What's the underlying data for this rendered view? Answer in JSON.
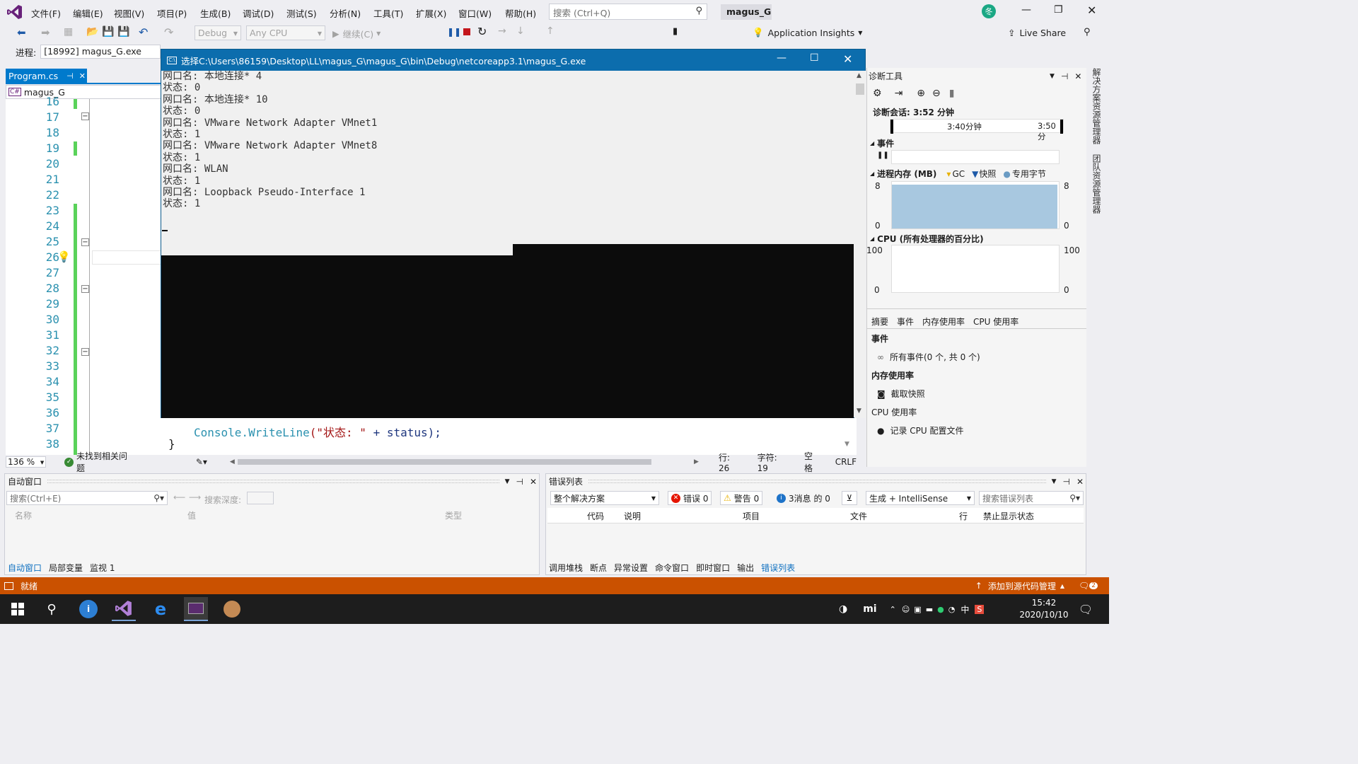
{
  "app": {
    "menu": [
      "文件(F)",
      "编辑(E)",
      "视图(V)",
      "项目(P)",
      "生成(B)",
      "调试(D)",
      "测试(S)",
      "分析(N)",
      "工具(T)",
      "扩展(X)",
      "窗口(W)",
      "帮助(H)"
    ],
    "search_placeholder": "搜索 (Ctrl+Q)",
    "solution_name": "magus_G",
    "user_initial": "冬",
    "accent": "#007acc"
  },
  "toolbar": {
    "config": "Debug",
    "platform": "Any CPU",
    "continue": "继续(C)",
    "app_insights": "Application Insights",
    "live_share": "Live Share",
    "process_label": "进程:",
    "process_value": "[18992] magus_G.exe"
  },
  "editor": {
    "tab_label": "Program.cs",
    "nav_left": "magus_G",
    "line_numbers": [
      "16",
      "17",
      "18",
      "19",
      "20",
      "21",
      "22",
      "23",
      "24",
      "25",
      "26",
      "27",
      "28",
      "29",
      "30",
      "31",
      "32",
      "33",
      "34",
      "35",
      "36",
      "37",
      "38"
    ],
    "code_line_37_method": "Console.WriteLine",
    "code_line_37_str": "(\"状态: \"",
    "code_line_37_tail": " + status);",
    "code_line_38": "}",
    "zoom": "136 %",
    "status_msg": "未找到相关问题",
    "pos_line": "行: 26",
    "pos_char": "字符: 19",
    "whitespace": "空格",
    "eol": "CRLF"
  },
  "console": {
    "title": "选择C:\\Users\\86159\\Desktop\\LL\\magus_G\\magus_G\\bin\\Debug\\netcoreapp3.1\\magus_G.exe",
    "lines": [
      "网口名: 本地连接* 4",
      "状态: 0",
      "网口名: 本地连接* 10",
      "状态: 0",
      "网口名: VMware Network Adapter VMnet1",
      "状态: 1",
      "网口名: VMware Network Adapter VMnet8",
      "状态: 1",
      "网口名: WLAN",
      "状态: 1",
      "网口名: Loopback Pseudo-Interface 1",
      "状态: 1"
    ]
  },
  "diag": {
    "title": "诊断工具",
    "session": "诊断会话: 3:52 分钟",
    "tick1": "3:40分钟",
    "tick2": "3:50分",
    "events": "事件",
    "memory": "进程内存 (MB)",
    "gc": "GC",
    "snapshot": "快照",
    "private_bytes": "专用字节",
    "mem_max": "8",
    "mem_min": "0",
    "cpu": "CPU (所有处理器的百分比)",
    "cpu_max": "100",
    "cpu_min": "0",
    "tabs": [
      "摘要",
      "事件",
      "内存使用率",
      "CPU 使用率"
    ],
    "sec_events": "事件",
    "all_events": "所有事件(0 个, 共 0 个)",
    "sec_memory": "内存使用率",
    "take_snapshot": "截取快照",
    "sec_cpu": "CPU 使用率",
    "record_cpu": "记录 CPU 配置文件",
    "side_tab1": "解决方案资源管理器",
    "side_tab2": "团队资源管理器",
    "mem_fill_color": "#a8c8e0"
  },
  "autos": {
    "title": "自动窗口",
    "search_placeholder": "搜索(Ctrl+E)",
    "depth_label": "搜索深度:",
    "col_name": "名称",
    "col_value": "值",
    "col_type": "类型",
    "tabs": [
      "自动窗口",
      "局部变量",
      "监视 1"
    ]
  },
  "errors": {
    "title": "错误列表",
    "scope": "整个解决方案",
    "errors": "错误 0",
    "warnings": "警告 0",
    "messages": "3消息 的 0",
    "build_filter": "生成 + IntelliSense",
    "search_placeholder": "搜索错误列表",
    "cols": [
      "代码",
      "说明",
      "项目",
      "文件",
      "行",
      "禁止显示状态"
    ],
    "tabs": [
      "调用堆栈",
      "断点",
      "异常设置",
      "命令窗口",
      "即时窗口",
      "输出",
      "错误列表"
    ]
  },
  "status": {
    "ready": "就绪",
    "source_control": "添加到源代码管理",
    "notif_count": "2"
  },
  "taskbar": {
    "time": "15:42",
    "date": "2020/10/10",
    "ime": "中"
  }
}
